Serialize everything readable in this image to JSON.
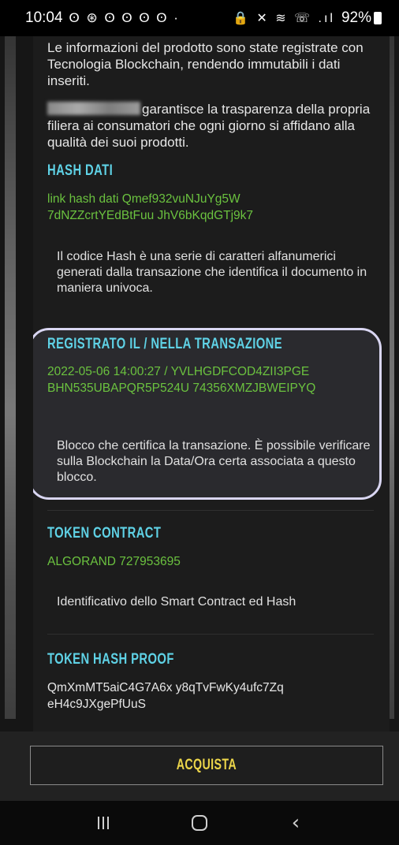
{
  "status_bar": {
    "time": "10:04",
    "notification_icons": "ʘ ⊛ ʘ ʘ ʘ ʘ ·",
    "system_icons": "🔒 ✕ ≋ ☏ .ıl",
    "battery": "92%"
  },
  "intro": {
    "paragraph1": "Le informazioni del prodotto sono state registrate con Tecnologia Blockchain, rendendo immutabili i dati inseriti.",
    "paragraph2": "garantisce la trasparenza della propria filiera ai consumatori che ogni giorno si affidano alla qualità dei suoi prodotti."
  },
  "hash_dati": {
    "title": "HASH DATI",
    "link_text": "link hash dati Qmef932vuNJuYg5W\n7dNZZcrtYEdBtFuu   JhV6bKqdGTj9k7",
    "description": "Il codice Hash è una serie di caratteri alfanumerici generati dalla transazione che identifica il documento in maniera univoca."
  },
  "registrato": {
    "title": "REGISTRATO IL / NELLA TRANSAZIONE",
    "value": "2022-05-06 14:00:27 / YVLHGDFCOD4ZII3PGE\nBHN535UBAPQR5P524U   74356XMZJBWEIPYQ",
    "description": "Blocco che certifica la transazione. È possibile verificare sulla Blockchain la Data/Ora certa associata a questo blocco."
  },
  "token_contract": {
    "title": "TOKEN CONTRACT",
    "value": "ALGORAND 727953695",
    "description": "Identificativo dello Smart Contract ed Hash"
  },
  "token_hash_proof": {
    "title": "TOKEN HASH PROOF",
    "value": "QmXmMT5aiC4G7A6x   y8qTvFwKy4ufc7Zq\neH4c9JXgePfUuS"
  },
  "footer": {
    "buy_label": "ACQUISTA"
  },
  "colors": {
    "accent_title": "#5fd2e6",
    "hash_green": "#6bc23f",
    "buy_yellow": "#ecd54a",
    "highlight_border": "#d9d6f2"
  }
}
